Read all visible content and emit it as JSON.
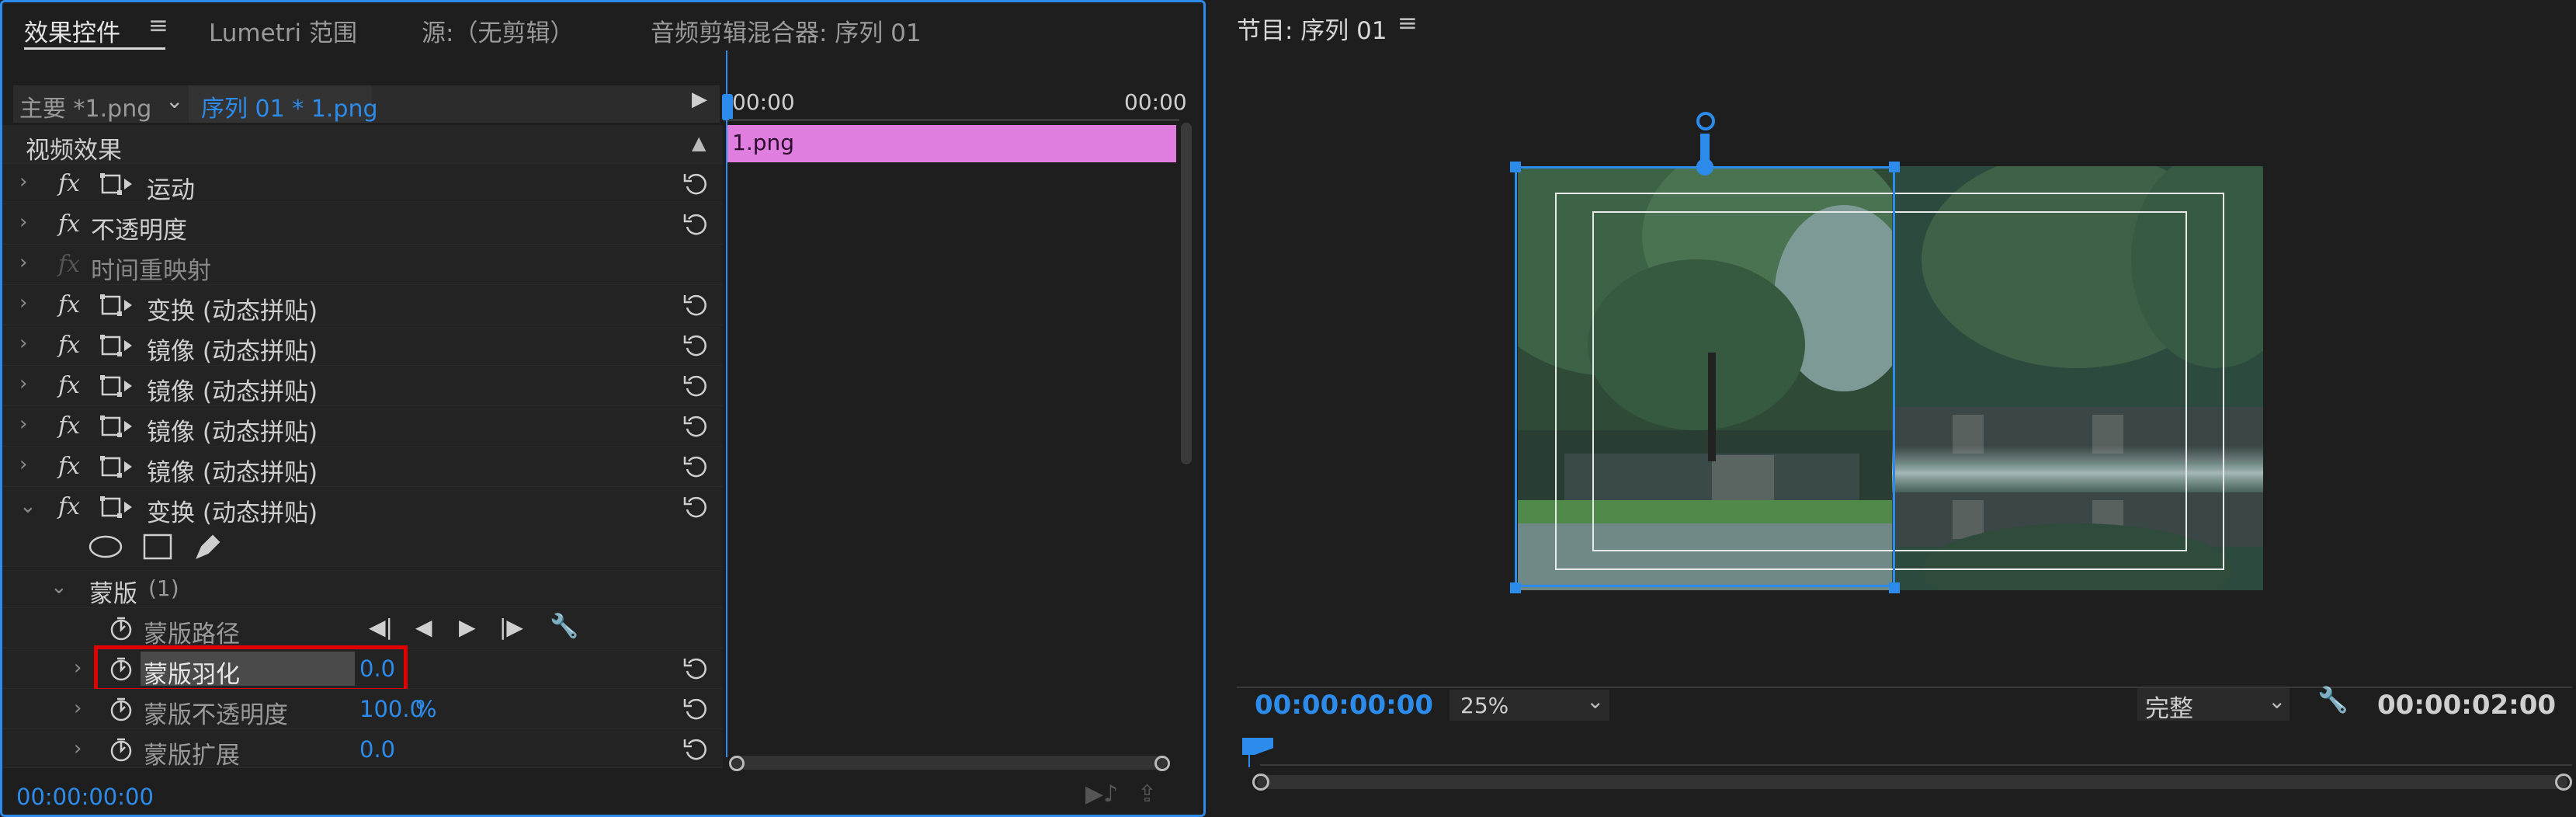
{
  "tabs": {
    "effect_controls": "效果控件",
    "lumetri": "Lumetri 范围",
    "source": "源:（无剪辑）",
    "audio_mixer": "音频剪辑混合器: 序列 01"
  },
  "header": {
    "master": "主要 *1.png",
    "sequence": "序列 01 * 1.png",
    "time_start": "00:00",
    "time_end": "00:00"
  },
  "clip_name": "1.png",
  "section_title": "视频效果",
  "effects": [
    {
      "name": "运动",
      "has_motion_icon": true,
      "dim": false
    },
    {
      "name": "不透明度",
      "has_motion_icon": false,
      "dim": false
    },
    {
      "name": "时间重映射",
      "has_motion_icon": false,
      "dim": true
    },
    {
      "name": "变换 (动态拼贴)",
      "has_motion_icon": true,
      "dim": false
    },
    {
      "name": "镜像 (动态拼贴)",
      "has_motion_icon": true,
      "dim": false
    },
    {
      "name": "镜像 (动态拼贴)",
      "has_motion_icon": true,
      "dim": false
    },
    {
      "name": "镜像 (动态拼贴)",
      "has_motion_icon": true,
      "dim": false
    },
    {
      "name": "镜像 (动态拼贴)",
      "has_motion_icon": true,
      "dim": false
    },
    {
      "name": "变换 (动态拼贴)",
      "has_motion_icon": true,
      "dim": false
    }
  ],
  "mask": {
    "name": "蒙版",
    "count": "(1)",
    "path_label": "蒙版路径",
    "feather_label": "蒙版羽化",
    "feather_value": "0.0",
    "opacity_label": "蒙版不透明度",
    "opacity_value": "100.0",
    "opacity_unit": "%",
    "expansion_label": "蒙版扩展",
    "expansion_value": "0.0"
  },
  "left_timecode": "00:00:00:00",
  "program": {
    "title": "节目: 序列 01",
    "timecode": "00:00:00:00",
    "zoom": "25%",
    "quality": "完整",
    "duration": "00:00:02:00"
  },
  "colors": {
    "accent": "#2d8ceb",
    "clip": "#e07ee0",
    "highlight": "#e00000"
  }
}
